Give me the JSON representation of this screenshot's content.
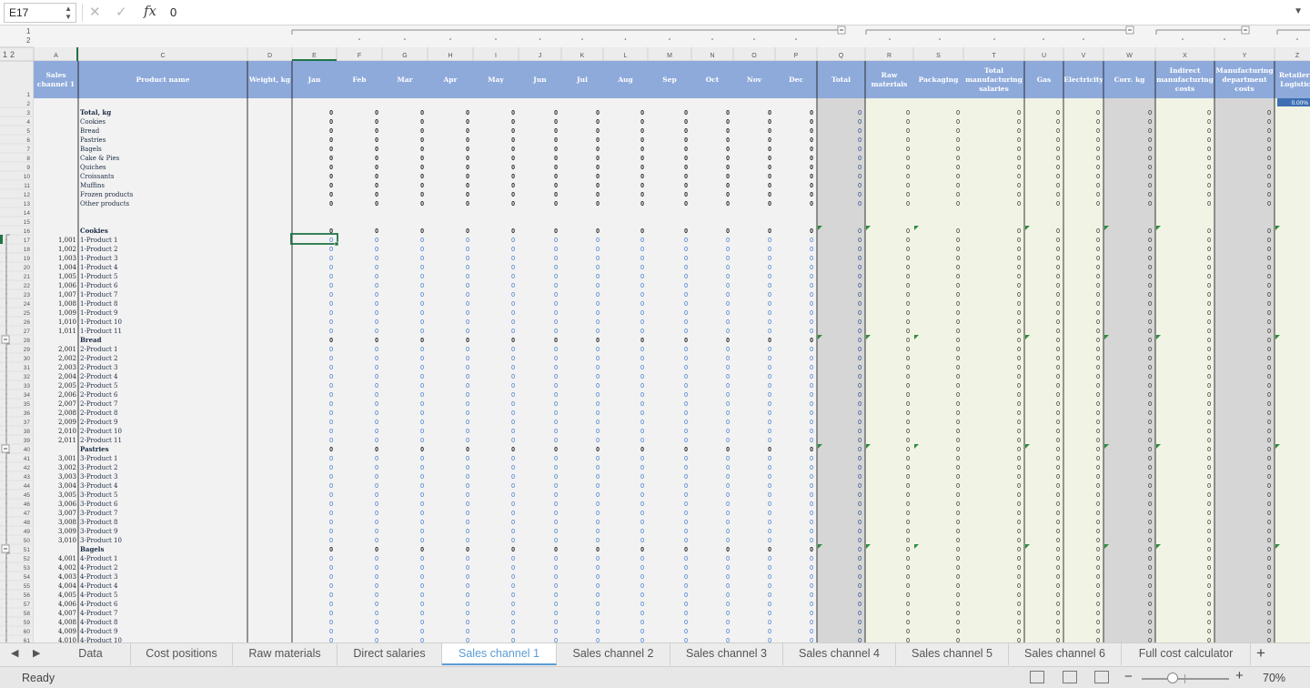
{
  "formula_bar": {
    "name_box": "E17",
    "fx_label": "fx",
    "value": "0"
  },
  "outline_levels": [
    "1",
    "2"
  ],
  "columns": [
    "A",
    "C",
    "D",
    "E",
    "F",
    "G",
    "H",
    "I",
    "J",
    "K",
    "L",
    "M",
    "N",
    "O",
    "P",
    "Q",
    "R",
    "S",
    "T",
    "U",
    "V",
    "W",
    "X",
    "Y",
    "Z"
  ],
  "headers": [
    "Sales channel 1",
    "Product name",
    "Weight, kg",
    "Jan",
    "Feb",
    "Mar",
    "Apr",
    "May",
    "Jun",
    "Jul",
    "Aug",
    "Sep",
    "Oct",
    "Nov",
    "Dec",
    "Total",
    "Raw materials",
    "Packaging",
    "Total manufacturing salaries",
    "Gas",
    "Electricity",
    "Corr. kg",
    "Indirect manufacturing costs",
    "Manufacturing department costs",
    "Retailer's Logistics"
  ],
  "z_header_value": "0.00%",
  "rows": [
    {
      "n": "2"
    },
    {
      "n": "3",
      "name": "Total, kg",
      "kind": "bold"
    },
    {
      "n": "4",
      "name": "Cookies",
      "kind": "sum"
    },
    {
      "n": "5",
      "name": "Bread",
      "kind": "sum"
    },
    {
      "n": "6",
      "name": "Pastries",
      "kind": "sum"
    },
    {
      "n": "7",
      "name": "Bagels",
      "kind": "sum"
    },
    {
      "n": "8",
      "name": "Cake & Pies",
      "kind": "sum"
    },
    {
      "n": "9",
      "name": "Quiches",
      "kind": "sum"
    },
    {
      "n": "10",
      "name": "Croissants",
      "kind": "sum"
    },
    {
      "n": "11",
      "name": "Muffins",
      "kind": "sum"
    },
    {
      "n": "12",
      "name": "Frozen products",
      "kind": "sum"
    },
    {
      "n": "13",
      "name": "Other products",
      "kind": "sum"
    },
    {
      "n": "14"
    },
    {
      "n": "15"
    },
    {
      "n": "16",
      "name": "Cookies",
      "kind": "bold"
    },
    {
      "n": "17",
      "code": "1,001",
      "name": "1-Product 1",
      "kind": "item"
    },
    {
      "n": "18",
      "code": "1,002",
      "name": "1-Product 2",
      "kind": "item"
    },
    {
      "n": "19",
      "code": "1,003",
      "name": "1-Product 3",
      "kind": "item"
    },
    {
      "n": "20",
      "code": "1,004",
      "name": "1-Product 4",
      "kind": "item"
    },
    {
      "n": "21",
      "code": "1,005",
      "name": "1-Product 5",
      "kind": "item"
    },
    {
      "n": "22",
      "code": "1,006",
      "name": "1-Product 6",
      "kind": "item"
    },
    {
      "n": "23",
      "code": "1,007",
      "name": "1-Product 7",
      "kind": "item"
    },
    {
      "n": "24",
      "code": "1,008",
      "name": "1-Product 8",
      "kind": "item"
    },
    {
      "n": "25",
      "code": "1,009",
      "name": "1-Product 9",
      "kind": "item"
    },
    {
      "n": "26",
      "code": "1,010",
      "name": "1-Product 10",
      "kind": "item"
    },
    {
      "n": "27",
      "code": "1,011",
      "name": "1-Product 11",
      "kind": "item"
    },
    {
      "n": "28",
      "name": "Bread",
      "kind": "bold"
    },
    {
      "n": "29",
      "code": "2,001",
      "name": "2-Product 1",
      "kind": "item"
    },
    {
      "n": "30",
      "code": "2,002",
      "name": "2-Product 2",
      "kind": "item"
    },
    {
      "n": "31",
      "code": "2,003",
      "name": "2-Product 3",
      "kind": "item"
    },
    {
      "n": "32",
      "code": "2,004",
      "name": "2-Product 4",
      "kind": "item"
    },
    {
      "n": "33",
      "code": "2,005",
      "name": "2-Product 5",
      "kind": "item"
    },
    {
      "n": "34",
      "code": "2,006",
      "name": "2-Product 6",
      "kind": "item"
    },
    {
      "n": "35",
      "code": "2,007",
      "name": "2-Product 7",
      "kind": "item"
    },
    {
      "n": "36",
      "code": "2,008",
      "name": "2-Product 8",
      "kind": "item"
    },
    {
      "n": "37",
      "code": "2,009",
      "name": "2-Product 9",
      "kind": "item"
    },
    {
      "n": "38",
      "code": "2,010",
      "name": "2-Product 10",
      "kind": "item"
    },
    {
      "n": "39",
      "code": "2,011",
      "name": "2-Product 11",
      "kind": "item"
    },
    {
      "n": "40",
      "name": "Pastries",
      "kind": "bold"
    },
    {
      "n": "41",
      "code": "3,001",
      "name": "3-Product 1",
      "kind": "item"
    },
    {
      "n": "42",
      "code": "3,002",
      "name": "3-Product 2",
      "kind": "item"
    },
    {
      "n": "43",
      "code": "3,003",
      "name": "3-Product 3",
      "kind": "item"
    },
    {
      "n": "44",
      "code": "3,004",
      "name": "3-Product 4",
      "kind": "item"
    },
    {
      "n": "45",
      "code": "3,005",
      "name": "3-Product 5",
      "kind": "item"
    },
    {
      "n": "46",
      "code": "3,006",
      "name": "3-Product 6",
      "kind": "item"
    },
    {
      "n": "47",
      "code": "3,007",
      "name": "3-Product 7",
      "kind": "item"
    },
    {
      "n": "48",
      "code": "3,008",
      "name": "3-Product 8",
      "kind": "item"
    },
    {
      "n": "49",
      "code": "3,009",
      "name": "3-Product 9",
      "kind": "item"
    },
    {
      "n": "50",
      "code": "3,010",
      "name": "3-Product 10",
      "kind": "item"
    },
    {
      "n": "51",
      "name": "Bagels",
      "kind": "bold"
    },
    {
      "n": "52",
      "code": "4,001",
      "name": "4-Product 1",
      "kind": "item"
    },
    {
      "n": "53",
      "code": "4,002",
      "name": "4-Product 2",
      "kind": "item"
    },
    {
      "n": "54",
      "code": "4,003",
      "name": "4-Product 3",
      "kind": "item"
    },
    {
      "n": "55",
      "code": "4,004",
      "name": "4-Product 4",
      "kind": "item"
    },
    {
      "n": "56",
      "code": "4,005",
      "name": "4-Product 5",
      "kind": "item"
    },
    {
      "n": "57",
      "code": "4,006",
      "name": "4-Product 6",
      "kind": "item"
    },
    {
      "n": "58",
      "code": "4,007",
      "name": "4-Product 7",
      "kind": "item"
    },
    {
      "n": "59",
      "code": "4,008",
      "name": "4-Product 8",
      "kind": "item"
    },
    {
      "n": "60",
      "code": "4,009",
      "name": "4-Product 9",
      "kind": "item"
    },
    {
      "n": "61",
      "code": "4,010",
      "name": "4-Product 10",
      "kind": "item"
    }
  ],
  "cell_value": "0",
  "sheet_tabs": [
    "Data",
    "Cost positions",
    "Raw materials",
    "Direct salaries",
    "Sales channel 1",
    "Sales channel 2",
    "Sales channel 3",
    "Sales channel 4",
    "Sales channel 5",
    "Sales channel 6",
    "Full cost calculator"
  ],
  "active_tab": "Sales channel 1",
  "status": {
    "ready": "Ready",
    "zoom": "70%"
  },
  "colors": {
    "header_blue": "#8eaadb",
    "total_gray": "#d6d6d6",
    "cost_green": "#f1f4e4",
    "value_blue": "#2f6fd1",
    "selection": "#217346"
  }
}
